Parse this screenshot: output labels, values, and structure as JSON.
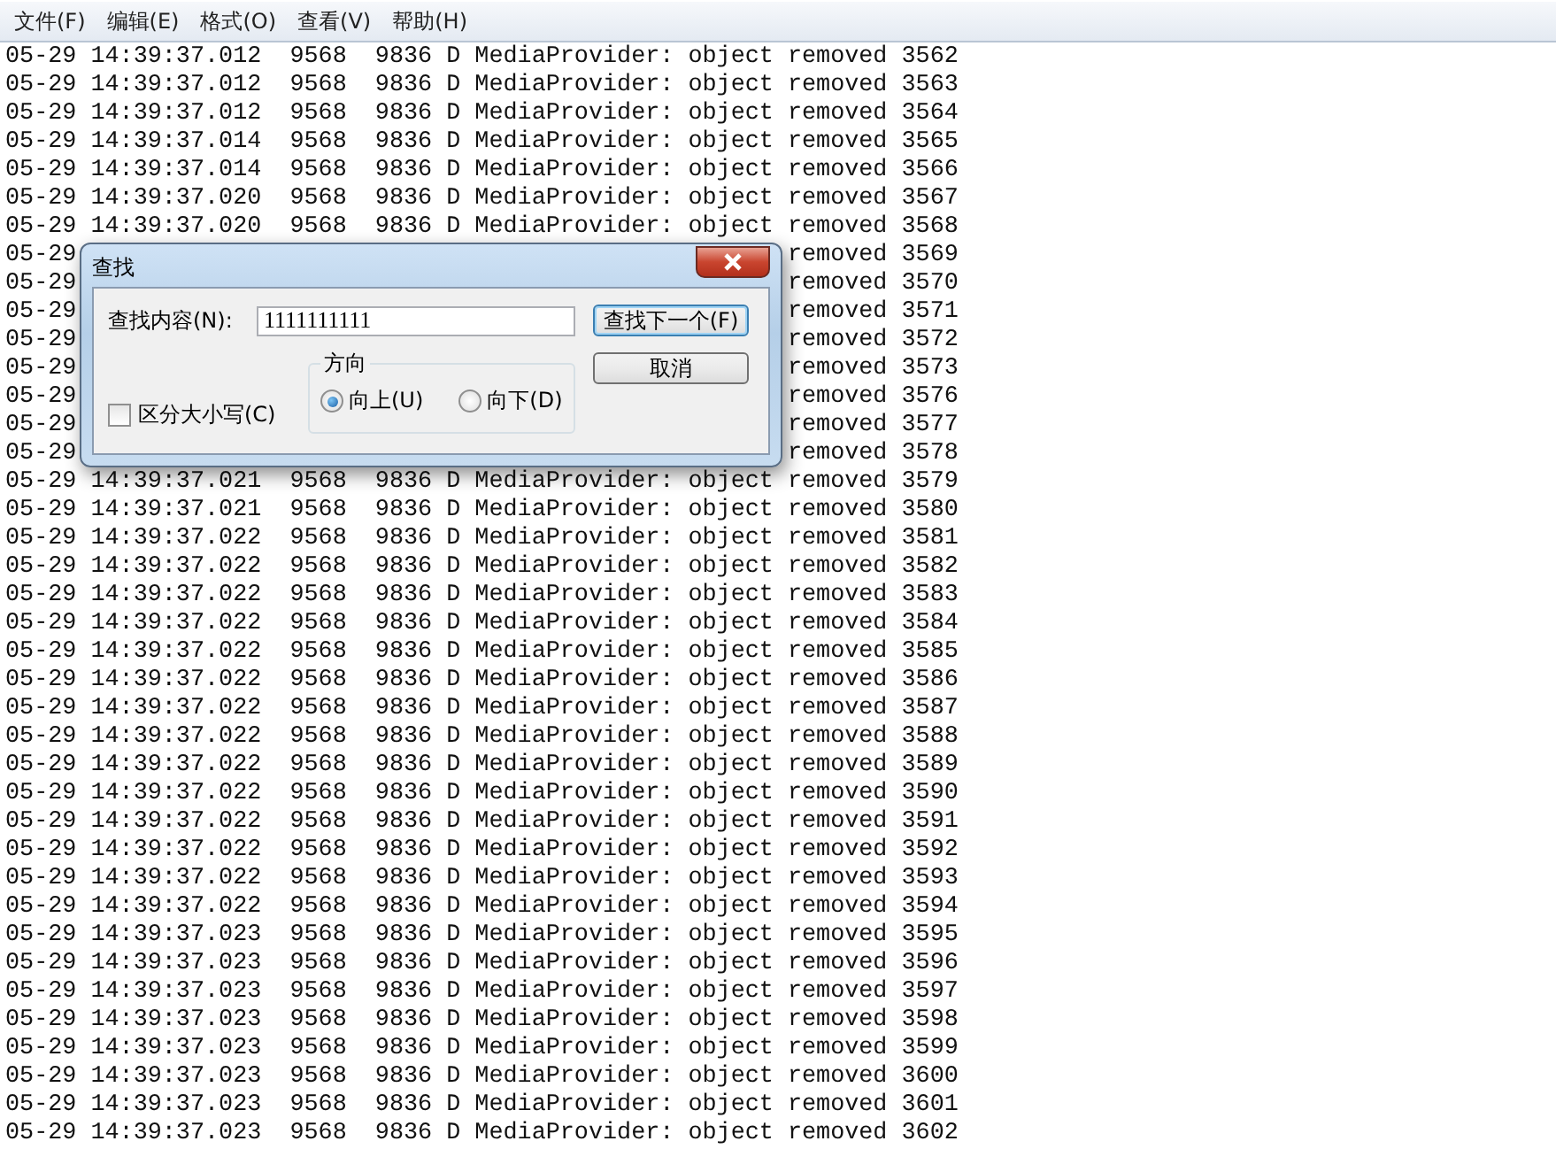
{
  "menu": [
    {
      "label": "文件(F)"
    },
    {
      "label": "编辑(E)"
    },
    {
      "label": "格式(O)"
    },
    {
      "label": "查看(V)"
    },
    {
      "label": "帮助(H)"
    }
  ],
  "log_lines": [
    {
      "kind": "full",
      "text": "05-29 14:39:37.012  9568  9836 D MediaProvider: object removed 3562"
    },
    {
      "kind": "full",
      "text": "05-29 14:39:37.012  9568  9836 D MediaProvider: object removed 3563"
    },
    {
      "kind": "full",
      "text": "05-29 14:39:37.012  9568  9836 D MediaProvider: object removed 3564"
    },
    {
      "kind": "full",
      "text": "05-29 14:39:37.014  9568  9836 D MediaProvider: object removed 3565"
    },
    {
      "kind": "full",
      "text": "05-29 14:39:37.014  9568  9836 D MediaProvider: object removed 3566"
    },
    {
      "kind": "full",
      "text": "05-29 14:39:37.020  9568  9836 D MediaProvider: object removed 3567"
    },
    {
      "kind": "full",
      "text": "05-29 14:39:37.020  9568  9836 D MediaProvider: object removed 3568"
    },
    {
      "kind": "partial",
      "left": "05-29",
      "right": "removed 3569"
    },
    {
      "kind": "partial",
      "left": "05-29",
      "right": "removed 3570"
    },
    {
      "kind": "partial",
      "left": "05-29",
      "right": "removed 3571"
    },
    {
      "kind": "partial",
      "left": "05-29",
      "right": "removed 3572"
    },
    {
      "kind": "partial",
      "left": "05-29",
      "right": "removed 3573"
    },
    {
      "kind": "partial",
      "left": "05-29",
      "right": "removed 3576"
    },
    {
      "kind": "partial",
      "left": "05-29",
      "right": "removed 3577"
    },
    {
      "kind": "partial",
      "left": "05-29",
      "right": "removed 3578"
    },
    {
      "kind": "full",
      "text": "05-29 14:39:37.021  9568  9836 D MediaProvider: object removed 3579"
    },
    {
      "kind": "full",
      "text": "05-29 14:39:37.021  9568  9836 D MediaProvider: object removed 3580"
    },
    {
      "kind": "full",
      "text": "05-29 14:39:37.022  9568  9836 D MediaProvider: object removed 3581"
    },
    {
      "kind": "full",
      "text": "05-29 14:39:37.022  9568  9836 D MediaProvider: object removed 3582"
    },
    {
      "kind": "full",
      "text": "05-29 14:39:37.022  9568  9836 D MediaProvider: object removed 3583"
    },
    {
      "kind": "full",
      "text": "05-29 14:39:37.022  9568  9836 D MediaProvider: object removed 3584"
    },
    {
      "kind": "full",
      "text": "05-29 14:39:37.022  9568  9836 D MediaProvider: object removed 3585"
    },
    {
      "kind": "full",
      "text": "05-29 14:39:37.022  9568  9836 D MediaProvider: object removed 3586"
    },
    {
      "kind": "full",
      "text": "05-29 14:39:37.022  9568  9836 D MediaProvider: object removed 3587"
    },
    {
      "kind": "full",
      "text": "05-29 14:39:37.022  9568  9836 D MediaProvider: object removed 3588"
    },
    {
      "kind": "full",
      "text": "05-29 14:39:37.022  9568  9836 D MediaProvider: object removed 3589"
    },
    {
      "kind": "full",
      "text": "05-29 14:39:37.022  9568  9836 D MediaProvider: object removed 3590"
    },
    {
      "kind": "full",
      "text": "05-29 14:39:37.022  9568  9836 D MediaProvider: object removed 3591"
    },
    {
      "kind": "full",
      "text": "05-29 14:39:37.022  9568  9836 D MediaProvider: object removed 3592"
    },
    {
      "kind": "full",
      "text": "05-29 14:39:37.022  9568  9836 D MediaProvider: object removed 3593"
    },
    {
      "kind": "full",
      "text": "05-29 14:39:37.022  9568  9836 D MediaProvider: object removed 3594"
    },
    {
      "kind": "full",
      "text": "05-29 14:39:37.023  9568  9836 D MediaProvider: object removed 3595"
    },
    {
      "kind": "full",
      "text": "05-29 14:39:37.023  9568  9836 D MediaProvider: object removed 3596"
    },
    {
      "kind": "full",
      "text": "05-29 14:39:37.023  9568  9836 D MediaProvider: object removed 3597"
    },
    {
      "kind": "full",
      "text": "05-29 14:39:37.023  9568  9836 D MediaProvider: object removed 3598"
    },
    {
      "kind": "full",
      "text": "05-29 14:39:37.023  9568  9836 D MediaProvider: object removed 3599"
    },
    {
      "kind": "full",
      "text": "05-29 14:39:37.023  9568  9836 D MediaProvider: object removed 3600"
    },
    {
      "kind": "full",
      "text": "05-29 14:39:37.023  9568  9836 D MediaProvider: object removed 3601"
    },
    {
      "kind": "full",
      "text": "05-29 14:39:37.023  9568  9836 D MediaProvider: object removed 3602"
    }
  ],
  "find_dialog": {
    "title": "查找",
    "find_label": "查找内容(N):",
    "find_value": "1111111111",
    "find_next_button": {
      "label": "查找下一个(F)",
      "focused": true
    },
    "cancel_button": {
      "label": "取消"
    },
    "match_case": {
      "label": "区分大小写(C)",
      "checked": false
    },
    "direction": {
      "label": "方向",
      "options": [
        {
          "label": "向上(U)",
          "selected": true
        },
        {
          "label": "向下(D)",
          "selected": false
        }
      ]
    }
  }
}
